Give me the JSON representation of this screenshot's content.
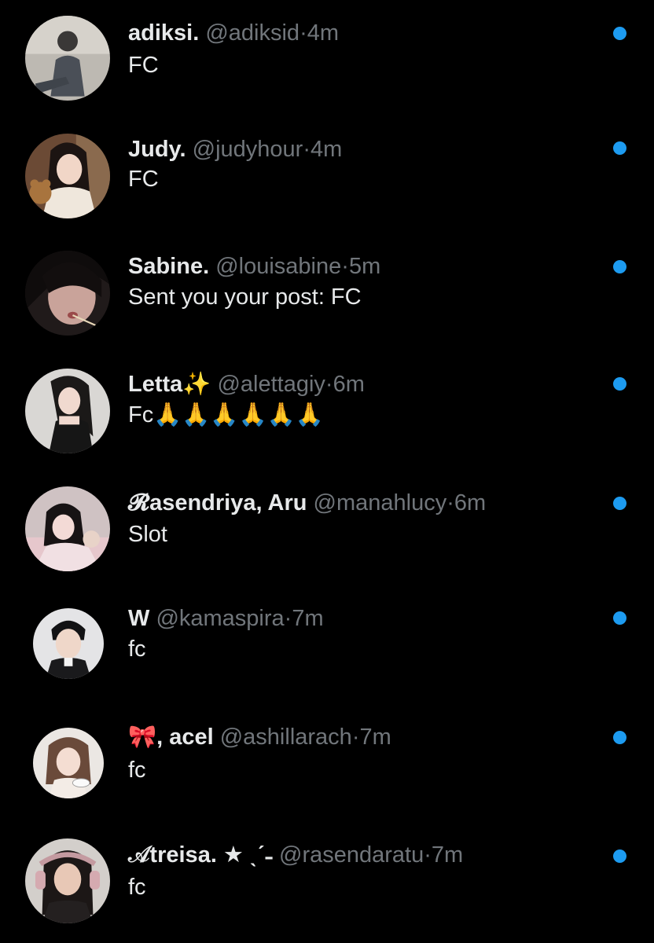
{
  "accent_color": "#1d9bf0",
  "messages": [
    {
      "name": "adiksi.",
      "handle": "@adiksid",
      "separator": "·",
      "time": "4m",
      "text": "FC",
      "avatar_icon": "avatar-photo-icon",
      "unread": true
    },
    {
      "name": "Judy.",
      "handle": "@judyhour",
      "separator": "·",
      "time": "4m",
      "text": "FC",
      "avatar_icon": "avatar-photo-icon",
      "unread": true
    },
    {
      "name": "Sabine.",
      "handle": "@louisabine",
      "separator": "·",
      "time": "5m",
      "text": "Sent you your post: FC",
      "avatar_icon": "avatar-photo-icon",
      "unread": true
    },
    {
      "name": "Letta✨",
      "handle": "@alettagiy",
      "separator": "·",
      "time": "6m",
      "text": "Fc🙏🙏🙏🙏🙏🙏",
      "avatar_icon": "avatar-photo-icon",
      "unread": true
    },
    {
      "name": "𝓡asendriya, Aru",
      "handle": "@manahlucy",
      "separator": "·",
      "time": "6m",
      "text": "Slot",
      "avatar_icon": "avatar-photo-icon",
      "unread": true
    },
    {
      "name": "W",
      "handle": "@kamaspira",
      "separator": "·",
      "time": "7m",
      "text": "fc",
      "avatar_icon": "avatar-photo-icon",
      "unread": true
    },
    {
      "name": "🎀, acel",
      "handle": "@ashillarach",
      "separator": "·",
      "time": "7m",
      "text": "fc",
      "avatar_icon": "avatar-photo-icon",
      "unread": true
    },
    {
      "name": "𝒜treisa. ★ ˎˊ˗",
      "handle": "@rasendaratu",
      "separator": "·",
      "time": "7m",
      "text": "fc",
      "avatar_icon": "avatar-photo-icon",
      "unread": true
    }
  ]
}
